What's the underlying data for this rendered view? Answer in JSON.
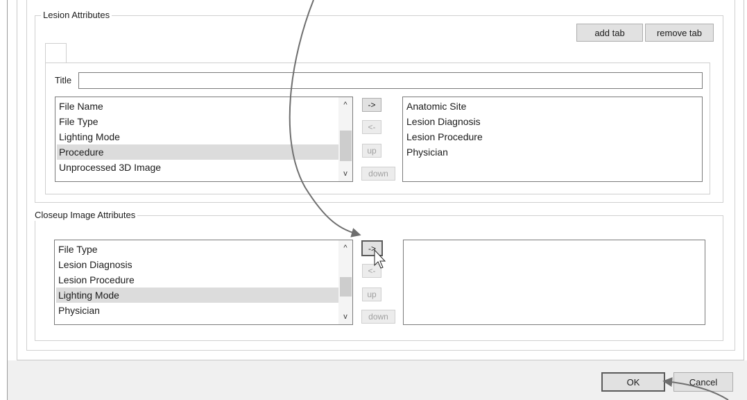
{
  "lesion_group": {
    "title": "Lesion Attributes",
    "add_tab_label": "add tab",
    "remove_tab_label": "remove tab",
    "title_field_label": "Title",
    "title_field_value": "",
    "available": [
      "File Name",
      "File Type",
      "Lighting Mode",
      "Procedure",
      "Unprocessed 3D Image"
    ],
    "selected_available": "Procedure",
    "chosen": [
      "Anatomic Site",
      "Lesion Diagnosis",
      "Lesion Procedure",
      "Physician"
    ],
    "btn_add": "->",
    "btn_remove": "<-",
    "btn_up": "up",
    "btn_down": "down"
  },
  "closeup_group": {
    "title": "Closeup Image Attributes",
    "available": [
      "File Type",
      "Lesion Diagnosis",
      "Lesion Procedure",
      "Lighting Mode",
      "Physician"
    ],
    "selected_available": "Lighting Mode",
    "chosen": [],
    "btn_add": "->",
    "btn_remove": "<-",
    "btn_up": "up",
    "btn_down": "down"
  },
  "footer": {
    "ok_label": "OK",
    "cancel_label": "Cancel"
  },
  "icons": {
    "scroll_up": "^",
    "scroll_down": "v"
  },
  "colors": {
    "selection": "#dcdcdc",
    "annotation_arrow": "#6e6e6e"
  }
}
